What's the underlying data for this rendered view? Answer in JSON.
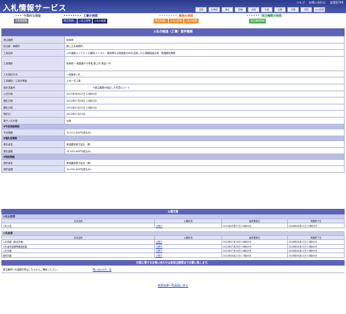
{
  "app_title": "入札情報サービス",
  "top_links": [
    "ヘルプ",
    "お問い合わせ",
    "全国窓708"
  ],
  "regions": [
    "全国",
    "北海道",
    "東北",
    "関東",
    "北陸",
    "中部",
    "近畿",
    "中国",
    "四国",
    "九州沖縄"
  ],
  "categories": [
    {
      "heading": "予算的な調査",
      "tabs": [
        "予算的情報",
        "発注見通し"
      ],
      "color": "gray"
    },
    {
      "heading": "工事の検索",
      "tabs": [
        "発注見通し",
        "入札公告等",
        "入札の経過"
      ],
      "color": "navy"
    },
    {
      "heading": "業務の検索",
      "tabs": [
        "発注見通し",
        "入札公告等",
        "入札の経過"
      ],
      "color": "orange"
    },
    {
      "heading": "発注機関の検索",
      "tabs": [
        "発注機関情報"
      ],
      "color": "green"
    }
  ],
  "page_heading": "入札の経過（工事）案件概要",
  "details": [
    {
      "key": "発注機関",
      "value": "岐阜県"
    },
    {
      "key": "担当部・事務所",
      "value": "郡上土木事務所"
    },
    {
      "key": "工事名称",
      "value": "公共道路メンテナンス補助(トンネル・橋梁等の点検調査)WRを活用した小規模橋梁点検・修繕委託業務"
    },
    {
      "key": "工事場所",
      "value": "岐阜県 一般国道472号他 郡上市 美並一円"
    },
    {
      "key": "入札契約方式",
      "value": "一般競争入札"
    },
    {
      "key": "工事種別／工事の等級",
      "value": "土木一式工事"
    },
    {
      "key": "設計書番号",
      "value": "※発注機関が設定した任意のコード"
    },
    {
      "key": "公告日時",
      "value": "2022年06月27日 10時00分"
    },
    {
      "key": "開札日時",
      "value": "2022年07月06日 10時00分"
    },
    {
      "key": "開札日時",
      "value": "2022年07月21日 10時00分"
    },
    {
      "key": "契約日",
      "value": "2022年07月25日"
    },
    {
      "key": "電子入札対象",
      "value": "対象"
    }
  ],
  "estimate_section": "予定価格情報",
  "estimate": [
    {
      "key": "予定価格",
      "value": "10,913,400円(税込み)"
    }
  ],
  "winner_section": "落札者情報",
  "winner": [
    {
      "key": "落札者名",
      "value": "美濃建設株式会社（株）"
    },
    {
      "key": "落札価格",
      "value": "10,440,400円(税込み)"
    }
  ],
  "contract_section": "契約情報",
  "contract": [
    {
      "key": "契約者名",
      "value": "美濃建設株式会社（株）"
    },
    {
      "key": "契約金額",
      "value": "10,440,400円(税込み)"
    }
  ],
  "documents": {
    "title": "公開文書",
    "notice_section": "入札公告等",
    "headers": [
      "文書名称",
      "公開状況",
      "最終更新日",
      "掲載終了日"
    ],
    "notice_rows": [
      [
        "入札公告",
        "公開中",
        "2022年06月27日 10時00分",
        "2026年06月01日 10時00分"
      ]
    ],
    "result_section": "入札経過",
    "result_rows": [
      [
        "入札情報（総合評価）",
        "公開中",
        "2022年07月26日 16時00分",
        "2026年06月01日 10時00分"
      ],
      [
        "入札者別金額等確認結果",
        "公開中",
        "2022年07月26日 16時00分",
        "2026年06月01日 10時00分"
      ],
      [
        "入札情報",
        "公開中",
        "2022年07月26日 16時00分",
        "2026年06月01日 10時00分"
      ],
      [
        "契約情報",
        "公開中",
        "2022年08月12日 17時00分",
        "2026年06月01日 10時00分"
      ]
    ]
  },
  "inquiry": {
    "title": "内容に関するお問い合わせは各発注機関までお願い致します。",
    "note": "発注機関への連絡先等はこちらからご確認ください。",
    "link": "問い合わせ先一覧"
  },
  "back_link": "検索結果一覧画面に戻る",
  "colors": {
    "header": "#2c3a8c",
    "section": "#5d63b8",
    "key_bg": "#dfe2f4",
    "link": "#2545b8"
  }
}
